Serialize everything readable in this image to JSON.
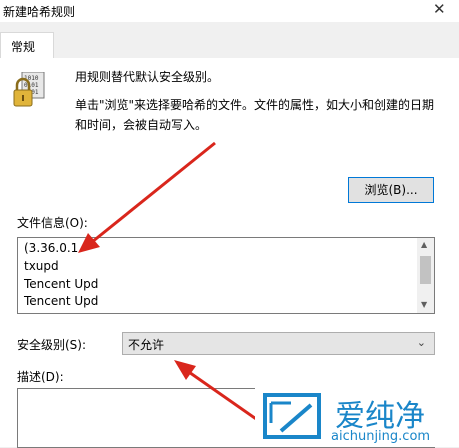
{
  "window": {
    "title": "新建哈希规则",
    "close_glyph": "✕"
  },
  "tabs": [
    {
      "label": "常规"
    }
  ],
  "description": {
    "line1": "用规则替代默认安全级别。",
    "line2": "单击\"浏览\"来选择要哈希的文件。文件的属性，如大小和创建的日期和时间，会被自动写入。"
  },
  "buttons": {
    "browse": "浏览(B)..."
  },
  "file_info": {
    "label": "文件信息(O):",
    "lines": [
      "(3.36.0.1",
      "txupd",
      "Tencent Upd",
      "Tencent Upd"
    ]
  },
  "security": {
    "label": "安全级别(S):",
    "value": "不允许"
  },
  "desc_field": {
    "label": "描述(D):",
    "value": ""
  },
  "watermark": {
    "chinese": "爱纯净",
    "url": "aichunjing.com"
  },
  "colors": {
    "arrow": "#d9261c",
    "accent": "#0078d7",
    "watermark": "#1a86c9"
  }
}
